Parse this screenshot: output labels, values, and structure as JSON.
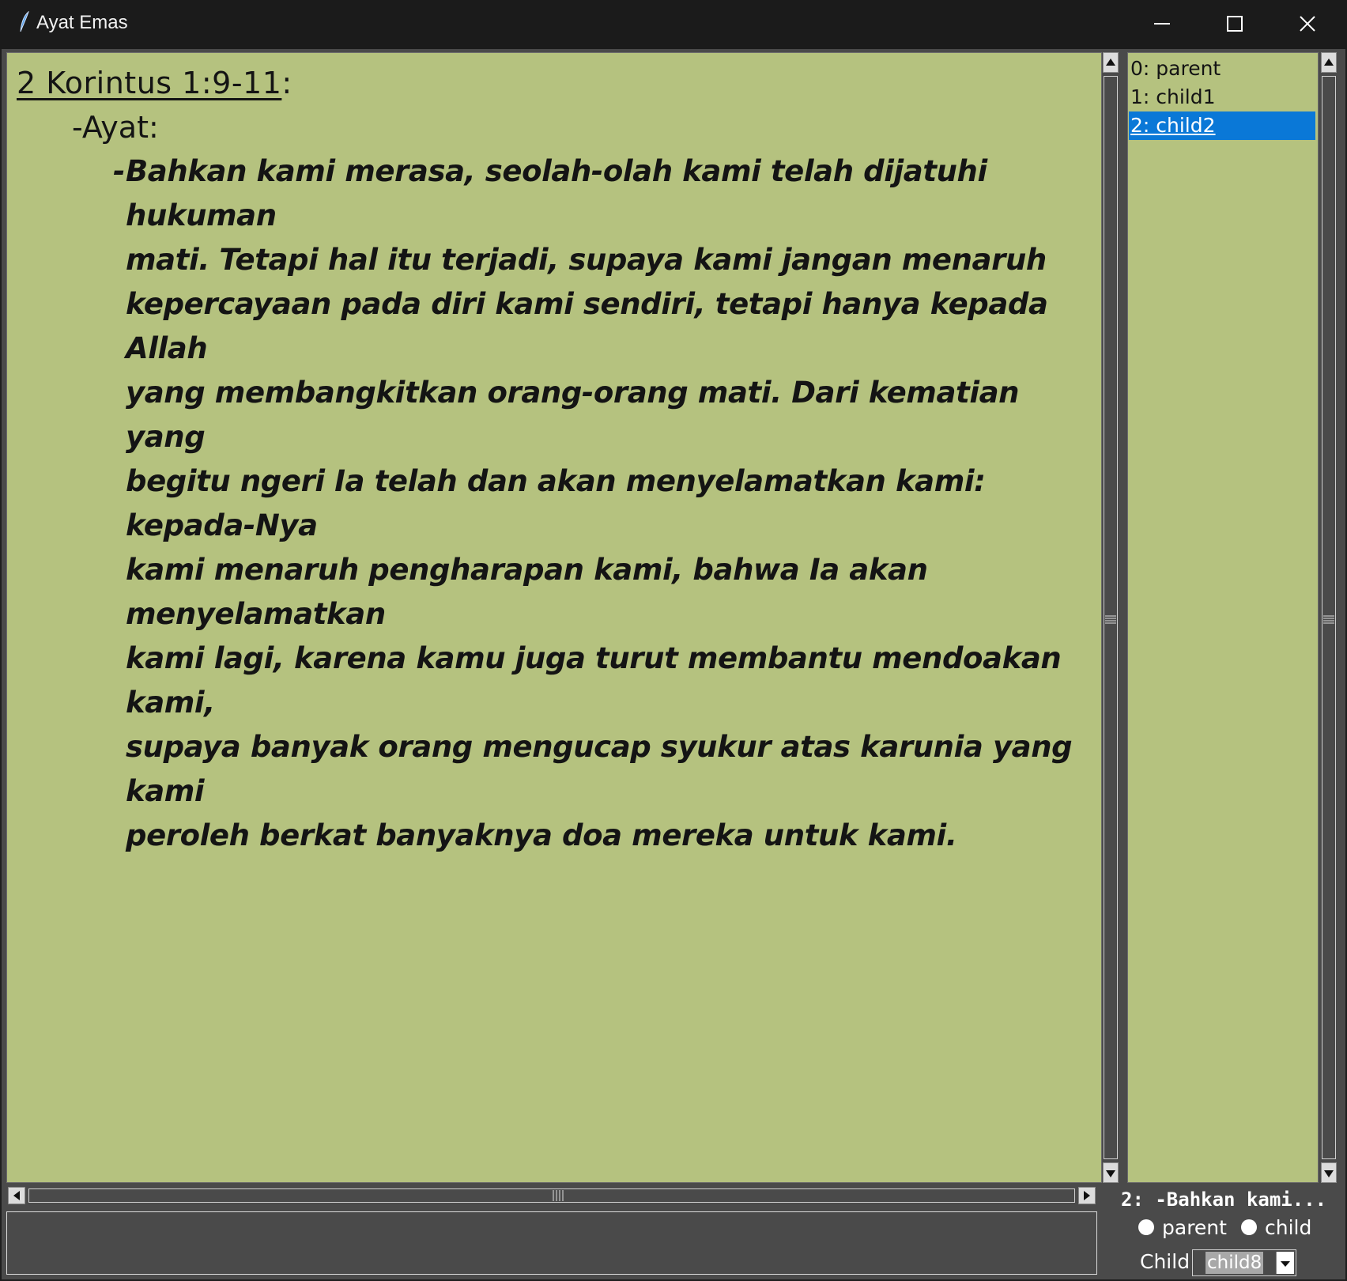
{
  "window": {
    "title": "Ayat Emas",
    "icon": "feather-icon",
    "controls": [
      "minimize-icon",
      "maximize-icon",
      "close-icon"
    ]
  },
  "editor": {
    "reference": "2 Korintus 1:9-11",
    "reference_suffix": ":",
    "ayat_label": "-Ayat:",
    "verse_dash": "-",
    "verse_text": "Bahkan kami merasa, seolah-olah kami telah dijatuhi hukuman\nmati. Tetapi hal itu terjadi, supaya kami jangan menaruh\nkepercayaan pada diri kami sendiri, tetapi hanya kepada Allah\nyang membangkitkan orang-orang mati. Dari kematian yang\nbegitu ngeri Ia telah dan akan menyelamatkan kami: kepada-Nya\nkami menaruh pengharapan kami, bahwa Ia akan menyelamatkan\nkami lagi, karena kamu juga turut membantu mendoakan kami,\nsupaya banyak orang mengucap syukur atas karunia yang kami\nperoleh berkat banyaknya doa mereka untuk kami.",
    "background": "#b5c27f"
  },
  "list": {
    "items": [
      {
        "label": "0: parent"
      },
      {
        "label": "1: child1"
      },
      {
        "label": "2: child2"
      }
    ],
    "selected_index": 2,
    "selection_color": "#0a78d7"
  },
  "preview": "2: -Bahkan kami...",
  "radios": {
    "parent_label": "parent",
    "child_label": "child"
  },
  "child_select": {
    "label": "Child",
    "value": "child8"
  },
  "entry": {
    "value": ""
  }
}
